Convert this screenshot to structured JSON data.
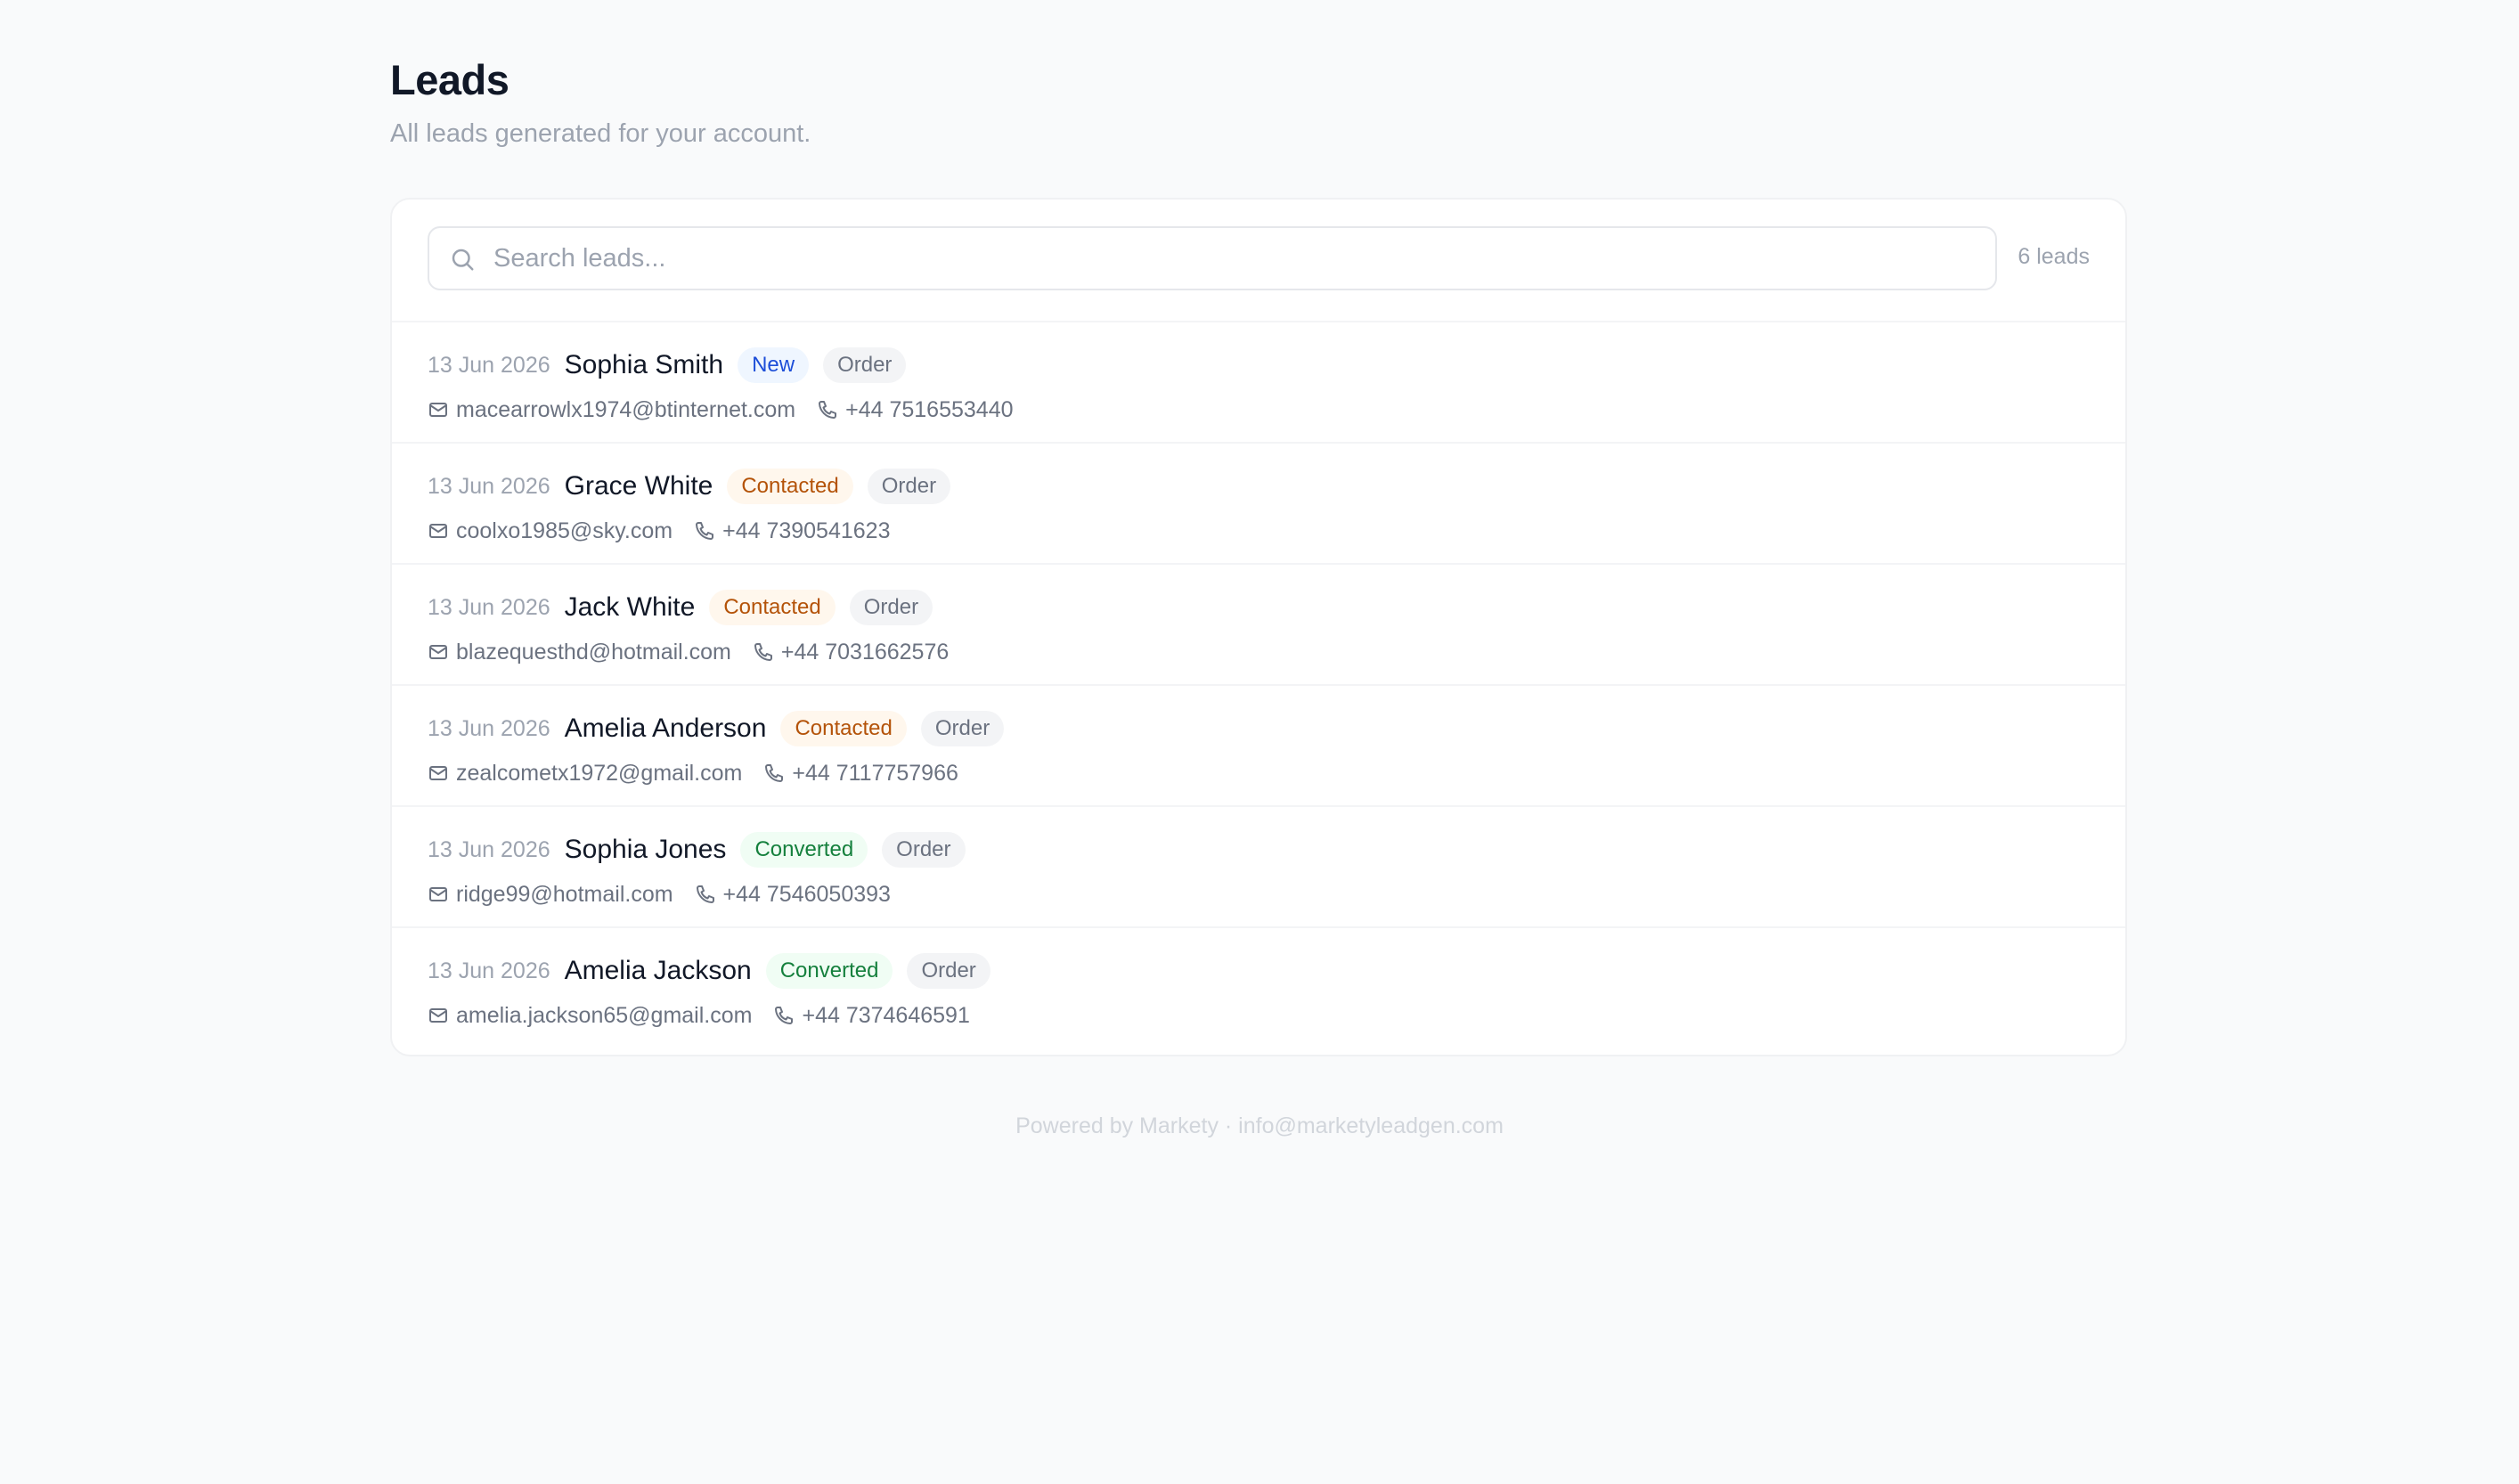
{
  "header": {
    "title": "Leads",
    "subtitle": "All leads generated for your account."
  },
  "search": {
    "placeholder": "Search leads...",
    "value": ""
  },
  "count_label": "6 leads",
  "colors": {
    "new": "#1d4ed8",
    "contacted": "#b45309",
    "converted": "#15803d"
  },
  "leads": [
    {
      "date": "13 Jun 2026",
      "name": "Sophia Smith",
      "status": "New",
      "status_key": "new",
      "type": "Order",
      "email": "macearrowlx1974@btinternet.com",
      "phone": "+44 7516553440"
    },
    {
      "date": "13 Jun 2026",
      "name": "Grace White",
      "status": "Contacted",
      "status_key": "contacted",
      "type": "Order",
      "email": "coolxo1985@sky.com",
      "phone": "+44 7390541623"
    },
    {
      "date": "13 Jun 2026",
      "name": "Jack White",
      "status": "Contacted",
      "status_key": "contacted",
      "type": "Order",
      "email": "blazequesthd@hotmail.com",
      "phone": "+44 7031662576"
    },
    {
      "date": "13 Jun 2026",
      "name": "Amelia Anderson",
      "status": "Contacted",
      "status_key": "contacted",
      "type": "Order",
      "email": "zealcometx1972@gmail.com",
      "phone": "+44 7117757966"
    },
    {
      "date": "13 Jun 2026",
      "name": "Sophia Jones",
      "status": "Converted",
      "status_key": "converted",
      "type": "Order",
      "email": "ridge99@hotmail.com",
      "phone": "+44 7546050393"
    },
    {
      "date": "13 Jun 2026",
      "name": "Amelia Jackson",
      "status": "Converted",
      "status_key": "converted",
      "type": "Order",
      "email": "amelia.jackson65@gmail.com",
      "phone": "+44 7374646591"
    }
  ],
  "footer": "Powered by Markety · info@marketyleadgen.com"
}
